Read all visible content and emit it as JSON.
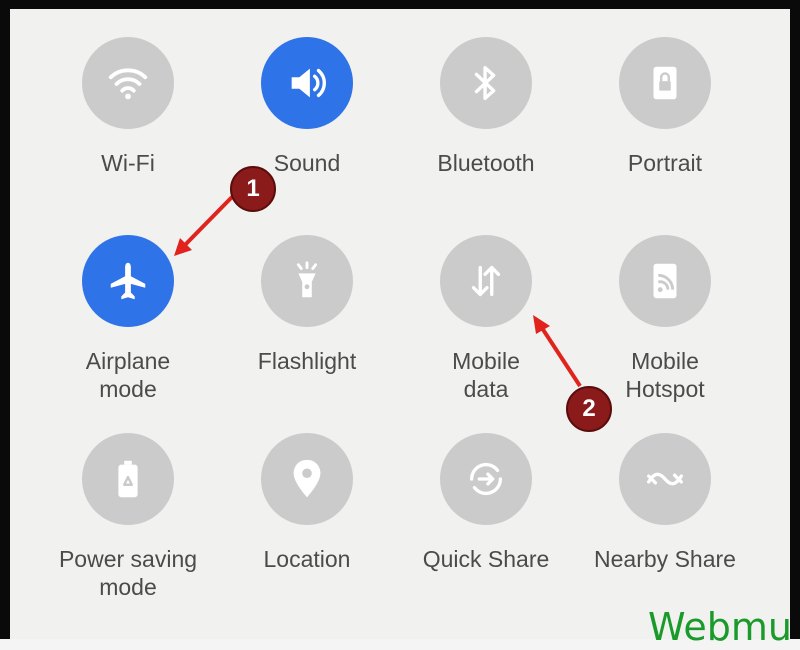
{
  "tiles": [
    {
      "label": "Wi-Fi",
      "icon": "wifi-icon",
      "active": false
    },
    {
      "label": "Sound",
      "icon": "sound-icon",
      "active": true
    },
    {
      "label": "Bluetooth",
      "icon": "bluetooth-icon",
      "active": false
    },
    {
      "label": "Portrait",
      "icon": "portrait-lock-icon",
      "active": false
    },
    {
      "label": "Airplane\nmode",
      "icon": "airplane-icon",
      "active": true
    },
    {
      "label": "Flashlight",
      "icon": "flashlight-icon",
      "active": false
    },
    {
      "label": "Mobile\ndata",
      "icon": "mobile-data-icon",
      "active": false
    },
    {
      "label": "Mobile\nHotspot",
      "icon": "hotspot-icon",
      "active": false
    },
    {
      "label": "Power saving\nmode",
      "icon": "battery-recycle-icon",
      "active": false
    },
    {
      "label": "Location",
      "icon": "location-pin-icon",
      "active": false
    },
    {
      "label": "Quick Share",
      "icon": "quick-share-icon",
      "active": false
    },
    {
      "label": "Nearby Share",
      "icon": "nearby-share-icon",
      "active": false
    }
  ],
  "annotations": {
    "marker1": "1",
    "marker2": "2"
  },
  "watermark": "Webmu",
  "colors": {
    "active": "#2e73e8",
    "inactive": "#cbcbcb",
    "marker": "#8b1a1a",
    "arrow": "#e0231c"
  }
}
